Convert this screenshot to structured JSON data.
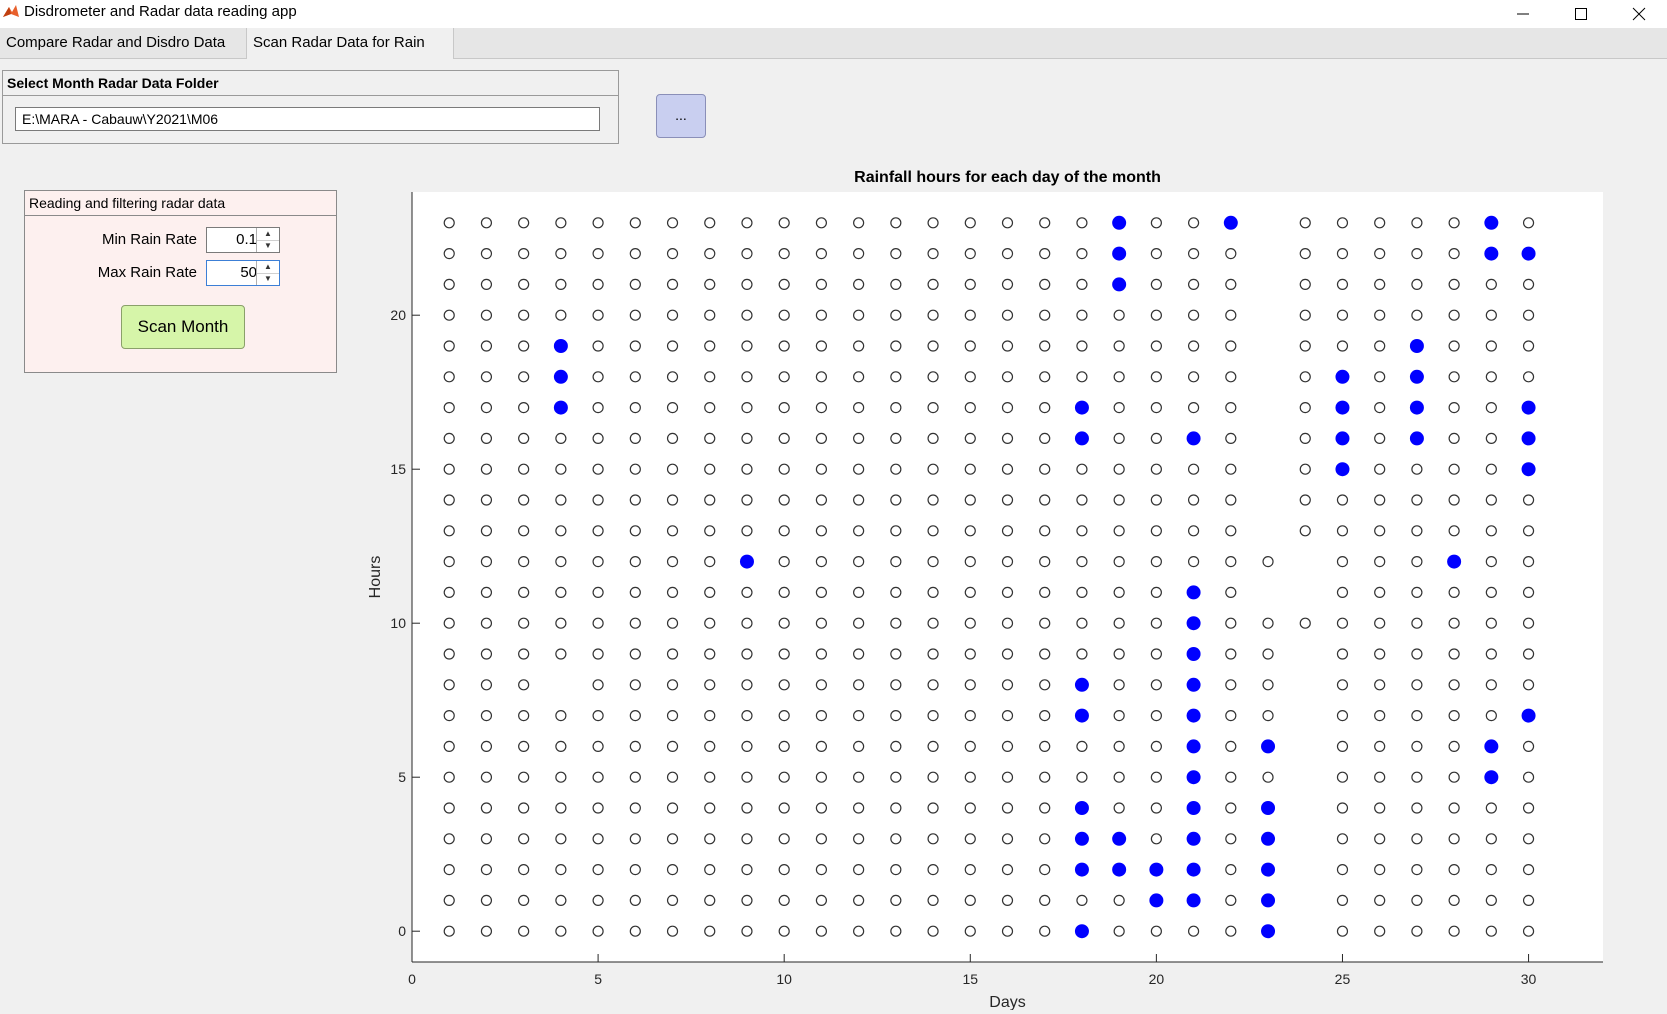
{
  "window": {
    "title": "Disdrometer and Radar data reading app"
  },
  "tabs": [
    {
      "label": "Compare Radar and Disdro Data"
    },
    {
      "label": "Scan Radar Data for Rain"
    }
  ],
  "folder_panel": {
    "title": "Select Month Radar Data Folder",
    "path_value": "E:\\MARA - Cabauw\\Y2021\\M06",
    "browse_label": "..."
  },
  "filter_panel": {
    "title": "Reading and filtering radar data",
    "min_label": "Min Rain Rate",
    "min_value": "0.1",
    "max_label": "Max Rain Rate",
    "max_value": "50",
    "scan_label": "Scan Month"
  },
  "colors": {
    "filled": "#0000ff",
    "empty": "#333333",
    "plot_bg": "#ffffff"
  },
  "chart_data": {
    "type": "scatter",
    "title": "Rainfall hours for each day of the month",
    "xlabel": "Days",
    "ylabel": "Hours",
    "xlim": [
      0,
      32
    ],
    "ylim": [
      -1,
      24
    ],
    "xticks": [
      0,
      5,
      10,
      15,
      20,
      25,
      30
    ],
    "yticks": [
      0,
      5,
      10,
      15,
      20
    ],
    "days": [
      1,
      2,
      3,
      4,
      5,
      6,
      7,
      8,
      9,
      10,
      11,
      12,
      13,
      14,
      15,
      16,
      17,
      18,
      19,
      20,
      21,
      22,
      23,
      24,
      25,
      26,
      27,
      28,
      29,
      30
    ],
    "hours": [
      0,
      1,
      2,
      3,
      4,
      5,
      6,
      7,
      8,
      9,
      10,
      11,
      12,
      13,
      14,
      15,
      16,
      17,
      18,
      19,
      20,
      21,
      22,
      23
    ],
    "missing": [
      [
        4,
        8
      ],
      [
        23,
        13
      ],
      [
        23,
        14
      ],
      [
        23,
        15
      ],
      [
        23,
        16
      ],
      [
        23,
        17
      ],
      [
        23,
        18
      ],
      [
        23,
        19
      ],
      [
        23,
        20
      ],
      [
        23,
        21
      ],
      [
        23,
        22
      ],
      [
        23,
        23
      ],
      [
        24,
        0
      ],
      [
        24,
        1
      ],
      [
        24,
        2
      ],
      [
        24,
        3
      ],
      [
        24,
        4
      ],
      [
        24,
        5
      ],
      [
        24,
        6
      ],
      [
        24,
        7
      ],
      [
        24,
        8
      ],
      [
        24,
        9
      ],
      [
        24,
        11
      ],
      [
        24,
        12
      ],
      [
        23,
        11
      ]
    ],
    "rain": [
      [
        4,
        17
      ],
      [
        4,
        18
      ],
      [
        4,
        19
      ],
      [
        9,
        12
      ],
      [
        18,
        0
      ],
      [
        18,
        2
      ],
      [
        18,
        3
      ],
      [
        18,
        4
      ],
      [
        18,
        7
      ],
      [
        18,
        8
      ],
      [
        18,
        16
      ],
      [
        18,
        17
      ],
      [
        19,
        2
      ],
      [
        19,
        3
      ],
      [
        19,
        21
      ],
      [
        19,
        22
      ],
      [
        19,
        23
      ],
      [
        20,
        1
      ],
      [
        20,
        2
      ],
      [
        21,
        1
      ],
      [
        21,
        2
      ],
      [
        21,
        3
      ],
      [
        21,
        4
      ],
      [
        21,
        5
      ],
      [
        21,
        6
      ],
      [
        21,
        7
      ],
      [
        21,
        8
      ],
      [
        21,
        9
      ],
      [
        21,
        10
      ],
      [
        21,
        11
      ],
      [
        21,
        16
      ],
      [
        22,
        23
      ],
      [
        23,
        0
      ],
      [
        23,
        1
      ],
      [
        23,
        2
      ],
      [
        23,
        3
      ],
      [
        23,
        4
      ],
      [
        23,
        6
      ],
      [
        25,
        15
      ],
      [
        25,
        16
      ],
      [
        25,
        17
      ],
      [
        25,
        18
      ],
      [
        27,
        16
      ],
      [
        27,
        17
      ],
      [
        27,
        18
      ],
      [
        27,
        19
      ],
      [
        28,
        12
      ],
      [
        29,
        5
      ],
      [
        29,
        6
      ],
      [
        29,
        22
      ],
      [
        29,
        23
      ],
      [
        30,
        7
      ],
      [
        30,
        15
      ],
      [
        30,
        16
      ],
      [
        30,
        17
      ],
      [
        30,
        22
      ]
    ]
  }
}
